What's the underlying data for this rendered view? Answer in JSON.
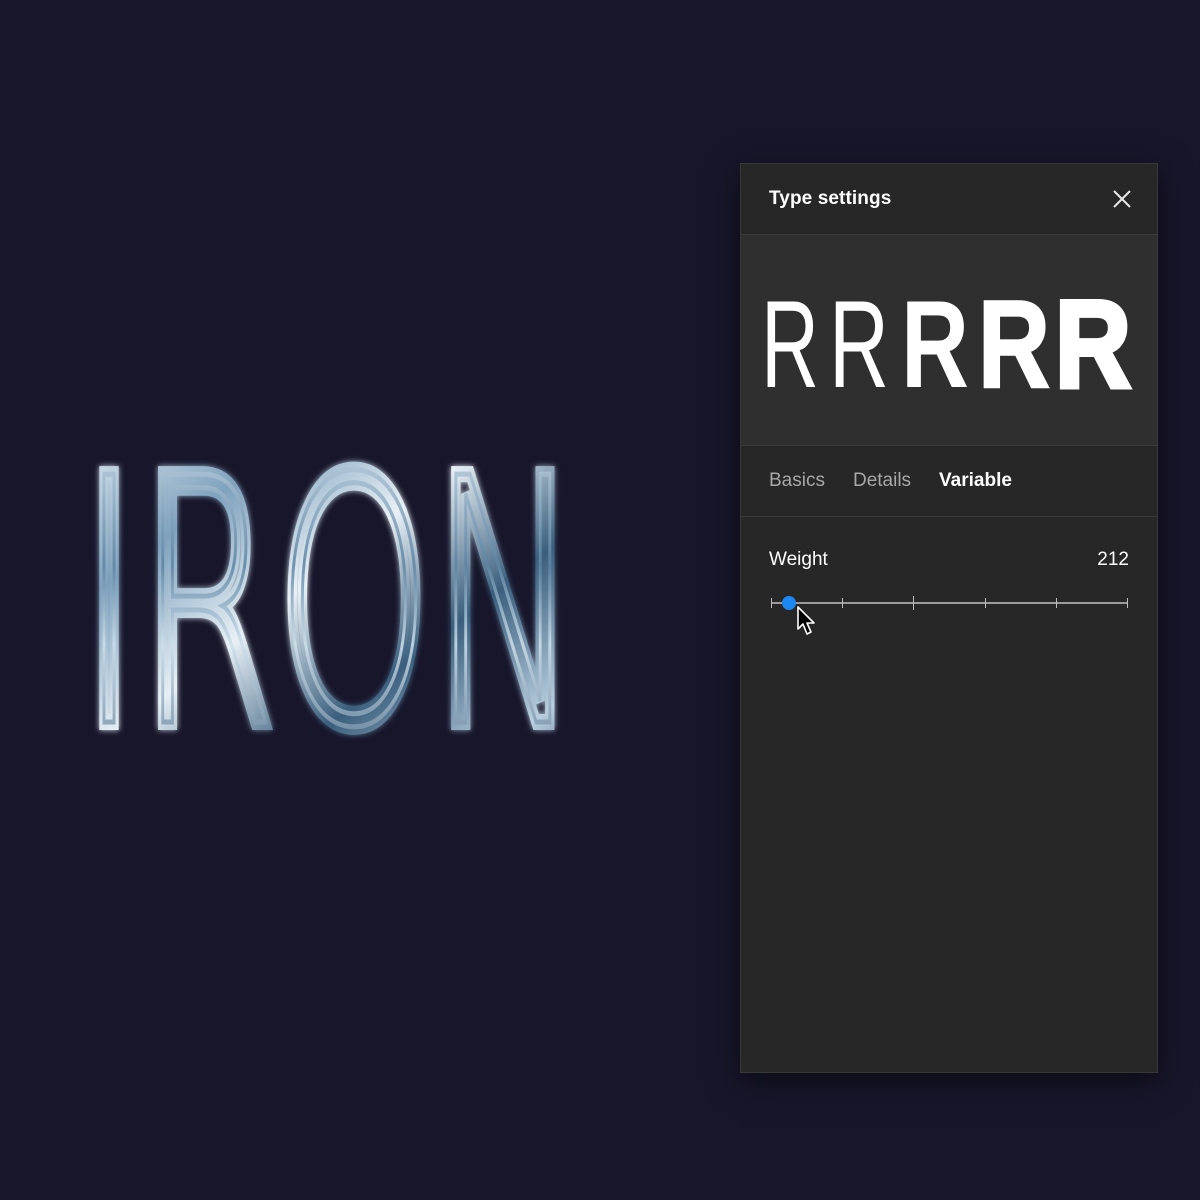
{
  "artwork": {
    "word": "IRON"
  },
  "panel": {
    "title": "Type settings",
    "preview_glyph": "R",
    "preview_weights": [
      200,
      350,
      600,
      750,
      900
    ],
    "tabs": [
      {
        "label": "Basics",
        "active": false
      },
      {
        "label": "Details",
        "active": false
      },
      {
        "label": "Variable",
        "active": true
      }
    ],
    "weight": {
      "label": "Weight",
      "value": "212",
      "slider_position": 0.03,
      "ticks": 6
    }
  },
  "colors": {
    "background": "#18162b",
    "panel": "#272727",
    "accent": "#1e88f2"
  },
  "icons": {
    "close": "close-icon",
    "cursor": "pointer-cursor-icon"
  }
}
